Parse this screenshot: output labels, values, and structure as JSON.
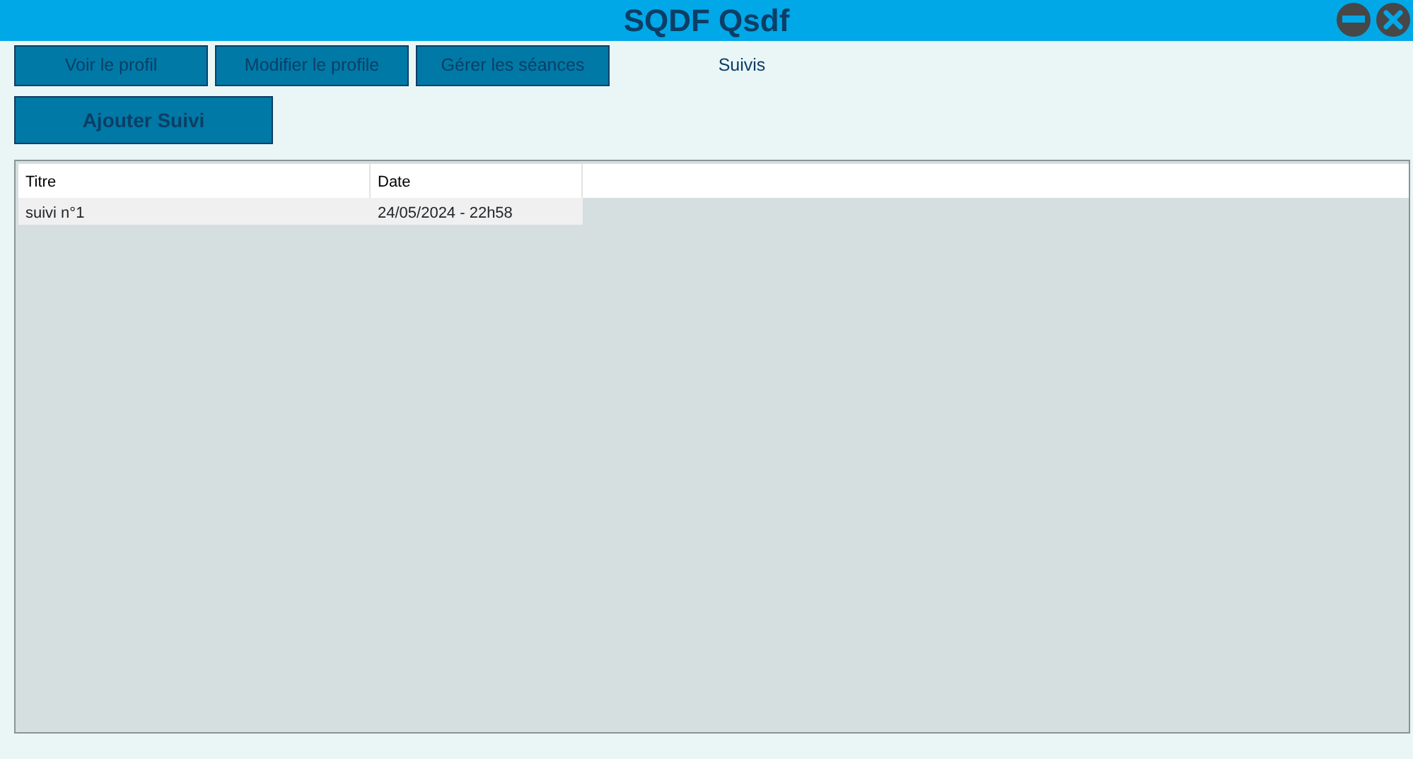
{
  "window": {
    "title": "SQDF Qsdf"
  },
  "tabs": [
    {
      "label": "Voir le profil",
      "selected": false
    },
    {
      "label": "Modifier le profile",
      "selected": false
    },
    {
      "label": "Gérer les séances",
      "selected": false
    },
    {
      "label": "Suivis",
      "selected": true
    }
  ],
  "add_button": {
    "label": "Ajouter Suivi"
  },
  "table": {
    "columns": [
      "Titre",
      "Date"
    ],
    "rows": [
      {
        "cells": [
          "suivi n°1",
          "24/05/2024 - 22h58"
        ]
      }
    ]
  }
}
